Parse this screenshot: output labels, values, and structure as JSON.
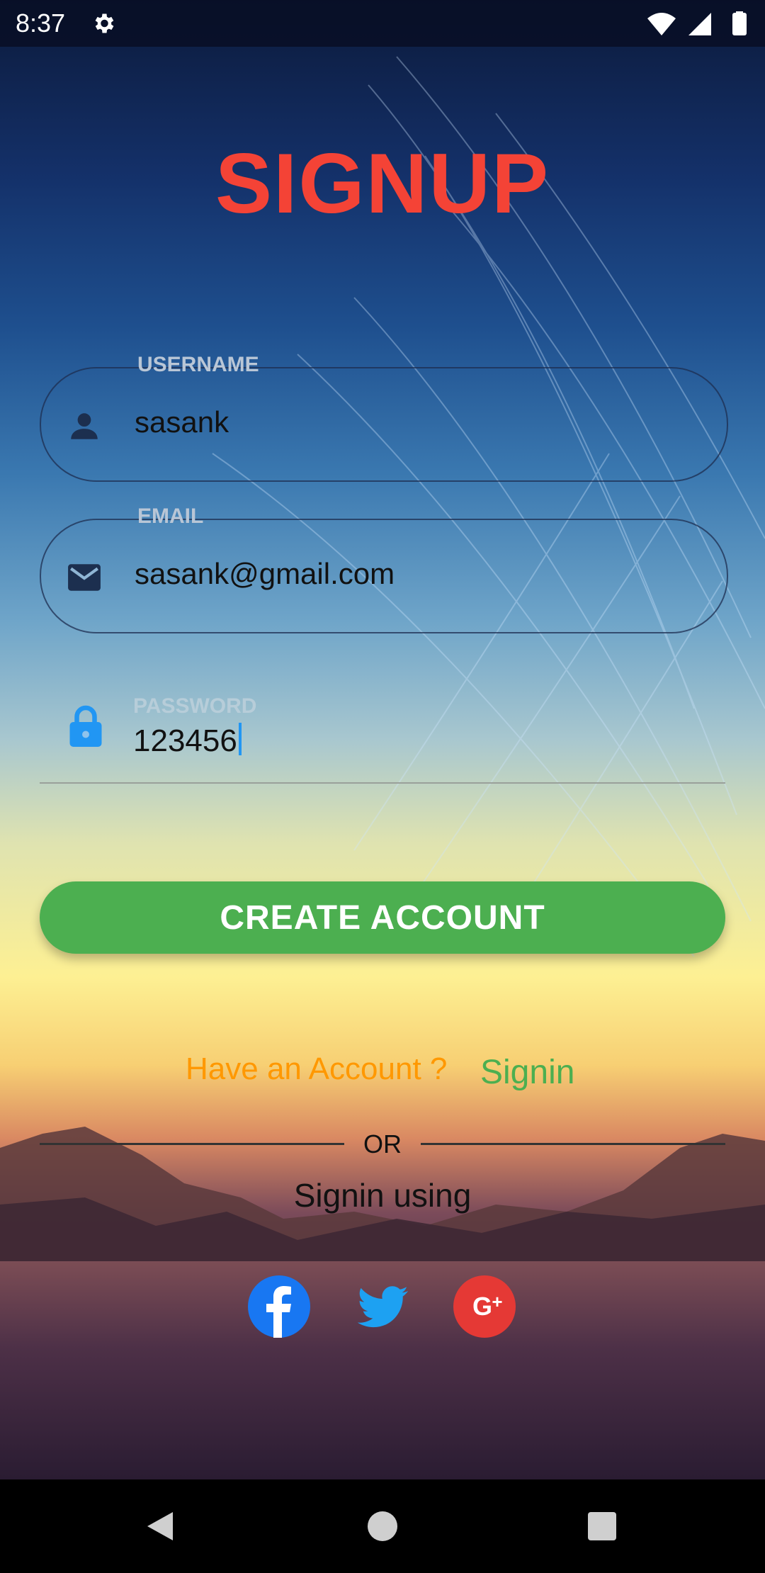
{
  "status_bar": {
    "time": "8:37",
    "icons": [
      "settings-icon",
      "wifi-icon",
      "cell-signal-icon",
      "battery-icon"
    ]
  },
  "page": {
    "title": "SIGNUP",
    "title_color": "#f44336"
  },
  "form": {
    "username": {
      "label": "USERNAME",
      "value": "sasank",
      "icon": "person-icon"
    },
    "email": {
      "label": "EMAIL",
      "value": "sasank@gmail.com",
      "icon": "mail-icon"
    },
    "password": {
      "label": "PASSWORD",
      "value": "123456",
      "icon": "lock-icon"
    }
  },
  "actions": {
    "create_account_label": "CREATE ACCOUNT",
    "create_account_color": "#4caf50",
    "have_account_text": "Have an Account ?",
    "have_account_color": "#ff9800",
    "signin_link": "Signin",
    "signin_link_color": "#4caf50"
  },
  "social": {
    "or_text": "OR",
    "signin_using": "Signin using",
    "providers": [
      "facebook-icon",
      "twitter-icon",
      "google-plus-icon"
    ]
  },
  "nav_bar": {
    "buttons": [
      "back-icon",
      "home-icon",
      "recents-icon"
    ]
  }
}
